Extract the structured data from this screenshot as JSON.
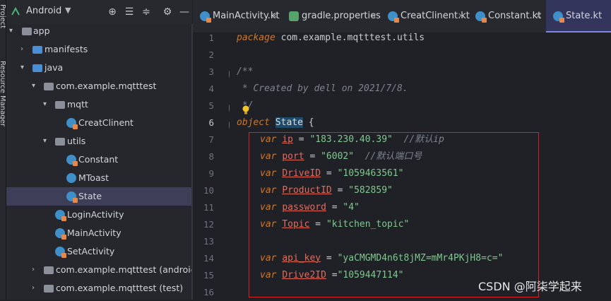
{
  "side_strip": {
    "labels": [
      "Project",
      "Resource Manager"
    ]
  },
  "project_panel": {
    "view_selector": "Android",
    "tree": [
      {
        "label": "app",
        "type": "module"
      },
      {
        "label": "manifests",
        "type": "folder"
      },
      {
        "label": "java",
        "type": "folder"
      },
      {
        "label": "com.example.mqtttest",
        "type": "package"
      },
      {
        "label": "mqtt",
        "type": "package"
      },
      {
        "label": "CreatClinent",
        "type": "kotlin-file"
      },
      {
        "label": "utils",
        "type": "package"
      },
      {
        "label": "Constant",
        "type": "kotlin-file"
      },
      {
        "label": "MToast",
        "type": "kotlin-class"
      },
      {
        "label": "State",
        "type": "kotlin-file",
        "selected": true
      },
      {
        "label": "LoginActivity",
        "type": "kotlin-file"
      },
      {
        "label": "MainActivity",
        "type": "kotlin-file"
      },
      {
        "label": "SetActivity",
        "type": "kotlin-file"
      },
      {
        "label": "com.example.mqtttest (androidTest)",
        "type": "package"
      },
      {
        "label": "com.example.mqtttest (test)",
        "type": "package"
      }
    ]
  },
  "tabs": [
    {
      "label": "MainActivity.kt",
      "icon": "kotlin-file-icon"
    },
    {
      "label": "gradle.properties",
      "icon": "gradle-icon"
    },
    {
      "label": "CreatClinent.kt",
      "icon": "kotlin-file-icon"
    },
    {
      "label": "Constant.kt",
      "icon": "kotlin-file-icon"
    },
    {
      "label": "State.kt",
      "icon": "kotlin-file-icon",
      "active": true
    }
  ],
  "editor": {
    "current_line": 6,
    "line_numbers": [
      "1",
      "2",
      "3",
      "4",
      "5",
      "6",
      "7",
      "8",
      "9",
      "10",
      "11",
      "12",
      "13",
      "14",
      "15",
      "16"
    ],
    "lines": {
      "l1_kw": "package",
      "l1_rest": " com.example.mqtttest.utils",
      "l3": "/**",
      "l4": " * Created by dell on 2021/7/8.",
      "l5": " */",
      "l6_kw": "object",
      "l6_name": "State",
      "l6_rest": " {",
      "vars": [
        {
          "name": "ip",
          "value": "\"183.230.40.39\"",
          "comment": "  //默认ip"
        },
        {
          "name": "port",
          "value": "\"6002\"",
          "comment": "  //默认端口号"
        },
        {
          "name": "DriveID",
          "value": "\"1059463561\"",
          "comment": ""
        },
        {
          "name": "ProductID",
          "value": "\"582859\"",
          "comment": ""
        },
        {
          "name": "password",
          "value": "\"4\"",
          "comment": ""
        },
        {
          "name": "Topic",
          "value": "\"kitchen_topic\"",
          "comment": ""
        },
        {
          "name": "api_key",
          "value": "\"yaCMGMD4n6t8jMZ=mMr4PKjH8=c=\"",
          "comment": ""
        },
        {
          "name": "Drive2ID",
          "value": "\"1059447114\"",
          "comment": ""
        }
      ],
      "var_kw": "var"
    }
  },
  "watermark": "CSDN @阿柒学起来",
  "colors": {
    "accent": "#7d86e0",
    "highlight_box": "#d92121",
    "selection": "#3d3f58"
  }
}
